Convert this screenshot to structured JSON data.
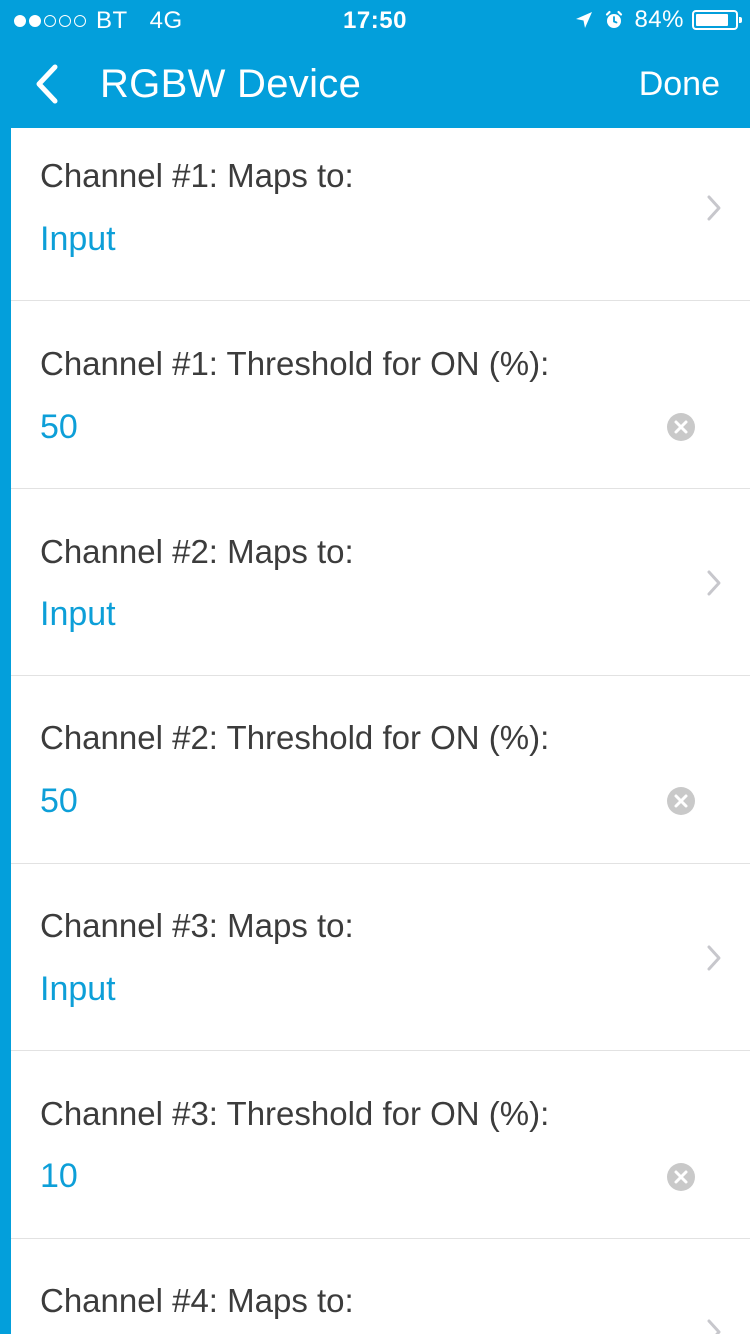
{
  "status_bar": {
    "carrier": "BT",
    "network": "4G",
    "time": "17:50",
    "battery_percent": "84%",
    "battery_level": 0.84,
    "signal_bars": 2,
    "signal_max": 5,
    "icons": [
      "location-arrow-icon",
      "alarm-clock-icon",
      "battery-icon"
    ]
  },
  "nav": {
    "back_icon": "chevron-left-icon",
    "title": "RGBW Device",
    "done_label": "Done"
  },
  "colors": {
    "accent": "#039fdb",
    "value_text": "#0d9fd8",
    "label_text": "#3c3c3c",
    "divider": "#e2e2e2",
    "clear_icon": "#c9c9c9",
    "chevron": "#c7c7cc"
  },
  "settings": [
    {
      "label": "Channel #1: Maps to:",
      "value": "Input",
      "control": "chevron-right-icon"
    },
    {
      "label": "Channel #1: Threshold for ON (%):",
      "value": "50",
      "control": "clear-icon"
    },
    {
      "label": "Channel #2: Maps to:",
      "value": "Input",
      "control": "chevron-right-icon"
    },
    {
      "label": "Channel #2: Threshold for ON (%):",
      "value": "50",
      "control": "clear-icon"
    },
    {
      "label": "Channel #3: Maps to:",
      "value": "Input",
      "control": "chevron-right-icon"
    },
    {
      "label": "Channel #3: Threshold for ON (%):",
      "value": "10",
      "control": "clear-icon"
    },
    {
      "label": "Channel #4: Maps to:",
      "value": "",
      "control": "chevron-right-icon"
    }
  ]
}
